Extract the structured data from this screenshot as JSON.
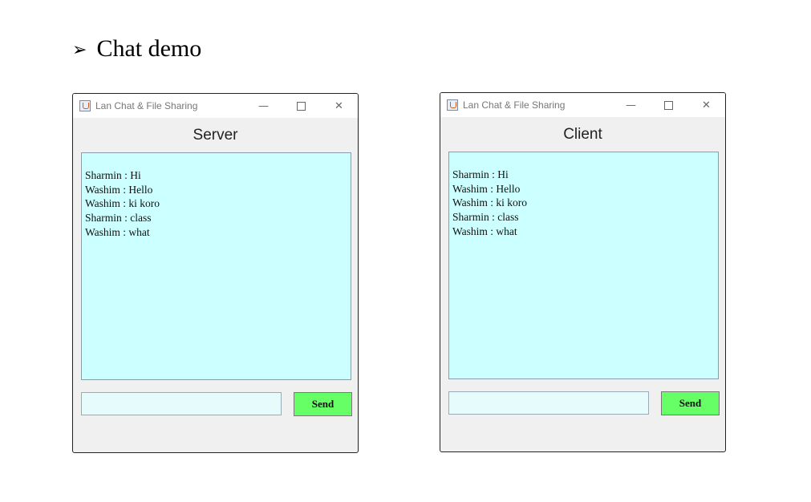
{
  "heading": {
    "bullet": "➢",
    "text": "Chat demo"
  },
  "server": {
    "window_title": "Lan Chat & File Sharing",
    "role_label": "Server",
    "messages": [
      "Sharmin : Hi",
      "Washim : Hello",
      "Washim : ki koro",
      "Sharmin : class",
      "Washim : what"
    ],
    "input_value": "",
    "send_label": "Send"
  },
  "client": {
    "window_title": "Lan Chat & File Sharing",
    "role_label": "Client",
    "messages": [
      "Sharmin : Hi",
      "Washim : Hello",
      "Washim : ki koro",
      "Sharmin : class",
      "Washim : what"
    ],
    "input_value": "",
    "send_label": "Send"
  },
  "window_controls": {
    "minimize": "—",
    "close": "✕"
  },
  "colors": {
    "chat_bg": "#ccffff",
    "send_button": "#66ff66",
    "input_bg": "#e6fbfb",
    "window_bg": "#f0f0f0"
  }
}
